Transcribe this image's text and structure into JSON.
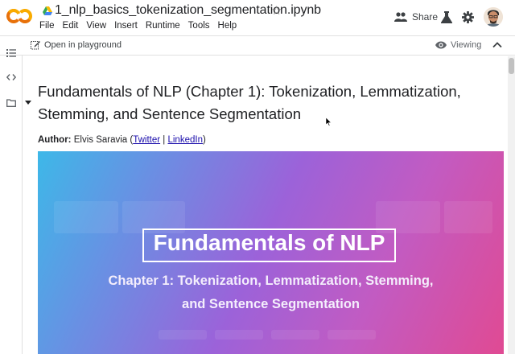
{
  "header": {
    "title": "1_nlp_basics_tokenization_segmentation.ipynb",
    "menu": [
      "File",
      "Edit",
      "View",
      "Insert",
      "Runtime",
      "Tools",
      "Help"
    ],
    "share_label": "Share",
    "brand_colors": {
      "logo_orange": "#f9ab00",
      "logo_dark_orange": "#e8710a"
    }
  },
  "toolbar": {
    "playground_label": "Open in playground",
    "viewing_label": "Viewing"
  },
  "sidebar": {
    "icons": [
      "table-of-contents-icon",
      "code-snippets-icon",
      "files-icon"
    ]
  },
  "notebook": {
    "heading": "Fundamentals of NLP (Chapter 1): Tokenization, Lemmatization, Stemming, and Sentence Segmentation",
    "author_label": "Author:",
    "author_name": "Elvis Saravia (",
    "twitter_link": "Twitter",
    "separator": " | ",
    "linkedin_link": "LinkedIn",
    "author_close": ")"
  },
  "banner": {
    "title": "Fundamentals of NLP",
    "subtitle_line1": "Chapter 1: Tokenization, Lemmatization, Stemming,",
    "subtitle_line2": "and Sentence Segmentation",
    "gradient_colors": [
      "#3db8e8",
      "#9c62d9",
      "#e04a93"
    ]
  }
}
